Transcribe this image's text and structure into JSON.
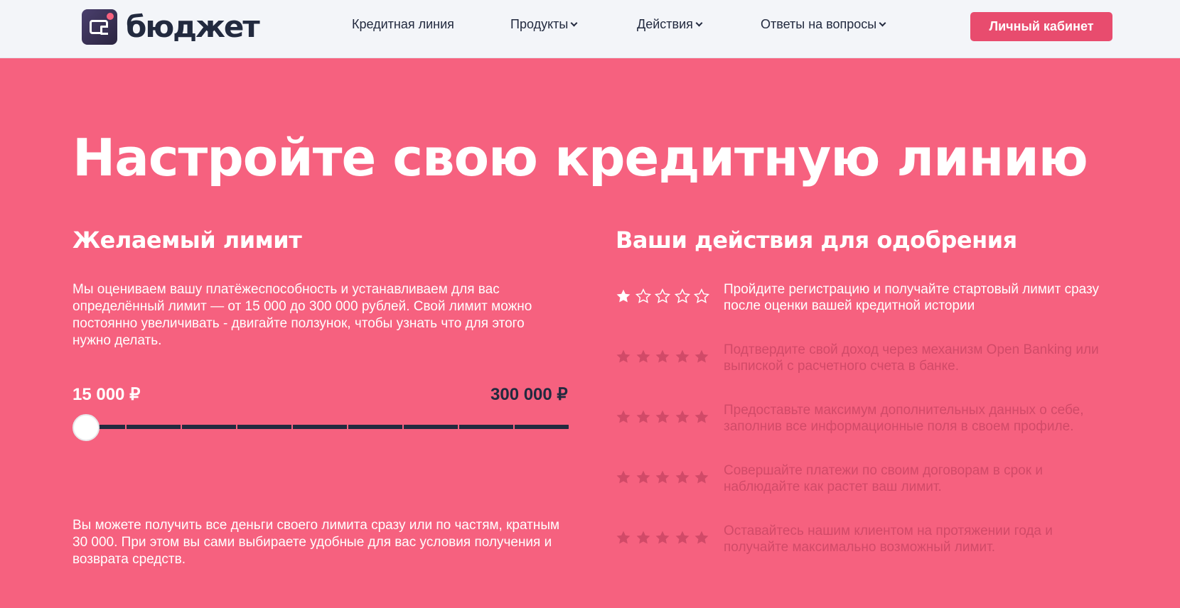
{
  "header": {
    "logo_text": "бюджет",
    "nav": [
      {
        "label": "Кредитная линия",
        "has_dropdown": false
      },
      {
        "label": "Продукты",
        "has_dropdown": true
      },
      {
        "label": "Действия",
        "has_dropdown": true
      },
      {
        "label": "Ответы на вопросы",
        "has_dropdown": true
      }
    ],
    "cabinet_button": "Личный кабинет"
  },
  "main": {
    "title": "Настройте свою кредитную линию",
    "limit": {
      "heading": "Желаемый лимит",
      "description": "Мы оцениваем вашу платёжеспособность и устанавливаем для вас определённый лимит — от 15 000 до 300 000 рублей. Свой лимит можно постоянно увеличивать - двигайте ползунок, чтобы узнать что для этого нужно делать.",
      "min_label": "15 000 ₽",
      "max_label": "300 000 ₽",
      "min_value": 15000,
      "max_value": 300000,
      "current_value": 15000,
      "footer": "Вы можете получить все деньги своего лимита сразу или по частям, кратным 30 000. При этом вы сами выбираете удобные для вас условия получения и возврата средств."
    },
    "actions": {
      "heading": "Ваши действия для одобрения",
      "steps": [
        {
          "text": "Пройдите регистрацию и получайте стартовый лимит сразу после оценки вашей кредитной истории",
          "filled_stars": 1,
          "total_stars": 5,
          "active": true
        },
        {
          "text": "Подтвердите свой доход через механизм Open Banking или выпиской с расчетного счета в банке.",
          "filled_stars": 0,
          "total_stars": 5,
          "active": false
        },
        {
          "text": "Предоставьте максимум дополнительных данных о себе, заполнив все информационные поля в своем профиле.",
          "filled_stars": 0,
          "total_stars": 5,
          "active": false
        },
        {
          "text": "Совершайте платежи по своим договорам в срок и наблюдайте как растет ваш лимит.",
          "filled_stars": 0,
          "total_stars": 5,
          "active": false
        },
        {
          "text": "Оставайтесь нашим клиентом на протяжении года и получайте максимально возможный лимит.",
          "filled_stars": 0,
          "total_stars": 5,
          "active": false
        }
      ]
    }
  },
  "colors": {
    "background": "#f6617f",
    "header_bg": "#f3f5f9",
    "dark": "#222a3f",
    "button": "#e84c6e",
    "inactive": "#d14a68",
    "white": "#ffffff"
  },
  "icons": [
    "wallet-logo-icon",
    "chevron-down-icon",
    "star-filled-icon",
    "star-outline-icon",
    "star-inactive-icon"
  ]
}
